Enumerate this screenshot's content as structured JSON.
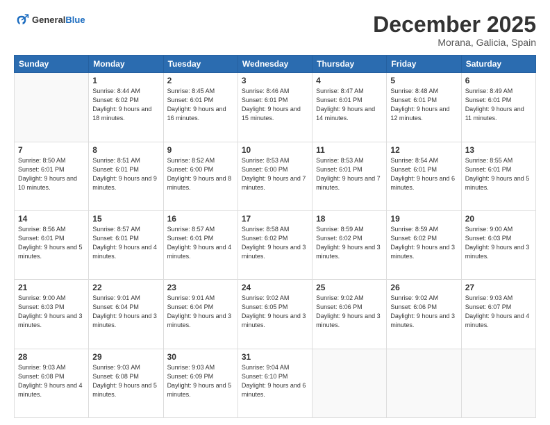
{
  "header": {
    "logo_line1": "General",
    "logo_line2": "Blue",
    "month": "December 2025",
    "location": "Morana, Galicia, Spain"
  },
  "weekdays": [
    "Sunday",
    "Monday",
    "Tuesday",
    "Wednesday",
    "Thursday",
    "Friday",
    "Saturday"
  ],
  "weeks": [
    [
      {
        "day": "",
        "info": ""
      },
      {
        "day": "1",
        "info": "Sunrise: 8:44 AM\nSunset: 6:02 PM\nDaylight: 9 hours\nand 18 minutes."
      },
      {
        "day": "2",
        "info": "Sunrise: 8:45 AM\nSunset: 6:01 PM\nDaylight: 9 hours\nand 16 minutes."
      },
      {
        "day": "3",
        "info": "Sunrise: 8:46 AM\nSunset: 6:01 PM\nDaylight: 9 hours\nand 15 minutes."
      },
      {
        "day": "4",
        "info": "Sunrise: 8:47 AM\nSunset: 6:01 PM\nDaylight: 9 hours\nand 14 minutes."
      },
      {
        "day": "5",
        "info": "Sunrise: 8:48 AM\nSunset: 6:01 PM\nDaylight: 9 hours\nand 12 minutes."
      },
      {
        "day": "6",
        "info": "Sunrise: 8:49 AM\nSunset: 6:01 PM\nDaylight: 9 hours\nand 11 minutes."
      }
    ],
    [
      {
        "day": "7",
        "info": "Sunrise: 8:50 AM\nSunset: 6:01 PM\nDaylight: 9 hours\nand 10 minutes."
      },
      {
        "day": "8",
        "info": "Sunrise: 8:51 AM\nSunset: 6:01 PM\nDaylight: 9 hours\nand 9 minutes."
      },
      {
        "day": "9",
        "info": "Sunrise: 8:52 AM\nSunset: 6:00 PM\nDaylight: 9 hours\nand 8 minutes."
      },
      {
        "day": "10",
        "info": "Sunrise: 8:53 AM\nSunset: 6:00 PM\nDaylight: 9 hours\nand 7 minutes."
      },
      {
        "day": "11",
        "info": "Sunrise: 8:53 AM\nSunset: 6:01 PM\nDaylight: 9 hours\nand 7 minutes."
      },
      {
        "day": "12",
        "info": "Sunrise: 8:54 AM\nSunset: 6:01 PM\nDaylight: 9 hours\nand 6 minutes."
      },
      {
        "day": "13",
        "info": "Sunrise: 8:55 AM\nSunset: 6:01 PM\nDaylight: 9 hours\nand 5 minutes."
      }
    ],
    [
      {
        "day": "14",
        "info": "Sunrise: 8:56 AM\nSunset: 6:01 PM\nDaylight: 9 hours\nand 5 minutes."
      },
      {
        "day": "15",
        "info": "Sunrise: 8:57 AM\nSunset: 6:01 PM\nDaylight: 9 hours\nand 4 minutes."
      },
      {
        "day": "16",
        "info": "Sunrise: 8:57 AM\nSunset: 6:01 PM\nDaylight: 9 hours\nand 4 minutes."
      },
      {
        "day": "17",
        "info": "Sunrise: 8:58 AM\nSunset: 6:02 PM\nDaylight: 9 hours\nand 3 minutes."
      },
      {
        "day": "18",
        "info": "Sunrise: 8:59 AM\nSunset: 6:02 PM\nDaylight: 9 hours\nand 3 minutes."
      },
      {
        "day": "19",
        "info": "Sunrise: 8:59 AM\nSunset: 6:02 PM\nDaylight: 9 hours\nand 3 minutes."
      },
      {
        "day": "20",
        "info": "Sunrise: 9:00 AM\nSunset: 6:03 PM\nDaylight: 9 hours\nand 3 minutes."
      }
    ],
    [
      {
        "day": "21",
        "info": "Sunrise: 9:00 AM\nSunset: 6:03 PM\nDaylight: 9 hours\nand 3 minutes."
      },
      {
        "day": "22",
        "info": "Sunrise: 9:01 AM\nSunset: 6:04 PM\nDaylight: 9 hours\nand 3 minutes."
      },
      {
        "day": "23",
        "info": "Sunrise: 9:01 AM\nSunset: 6:04 PM\nDaylight: 9 hours\nand 3 minutes."
      },
      {
        "day": "24",
        "info": "Sunrise: 9:02 AM\nSunset: 6:05 PM\nDaylight: 9 hours\nand 3 minutes."
      },
      {
        "day": "25",
        "info": "Sunrise: 9:02 AM\nSunset: 6:06 PM\nDaylight: 9 hours\nand 3 minutes."
      },
      {
        "day": "26",
        "info": "Sunrise: 9:02 AM\nSunset: 6:06 PM\nDaylight: 9 hours\nand 3 minutes."
      },
      {
        "day": "27",
        "info": "Sunrise: 9:03 AM\nSunset: 6:07 PM\nDaylight: 9 hours\nand 4 minutes."
      }
    ],
    [
      {
        "day": "28",
        "info": "Sunrise: 9:03 AM\nSunset: 6:08 PM\nDaylight: 9 hours\nand 4 minutes."
      },
      {
        "day": "29",
        "info": "Sunrise: 9:03 AM\nSunset: 6:08 PM\nDaylight: 9 hours\nand 5 minutes."
      },
      {
        "day": "30",
        "info": "Sunrise: 9:03 AM\nSunset: 6:09 PM\nDaylight: 9 hours\nand 5 minutes."
      },
      {
        "day": "31",
        "info": "Sunrise: 9:04 AM\nSunset: 6:10 PM\nDaylight: 9 hours\nand 6 minutes."
      },
      {
        "day": "",
        "info": ""
      },
      {
        "day": "",
        "info": ""
      },
      {
        "day": "",
        "info": ""
      }
    ]
  ]
}
